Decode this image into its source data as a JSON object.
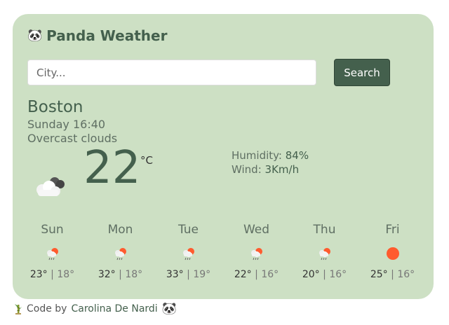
{
  "app": {
    "title": "Panda Weather",
    "brand_color": "#44604d",
    "card_color": "#cde0c4"
  },
  "search": {
    "placeholder": "City...",
    "value": "",
    "button_label": "Search"
  },
  "current": {
    "city": "Boston",
    "datetime": "Sunday 16:40",
    "description": "Overcast clouds",
    "icon": "overcast-clouds-icon",
    "temperature": "22",
    "unit": "°C",
    "humidity_label": "Humidity:",
    "humidity_value": "84%",
    "wind_label": "Wind:",
    "wind_value": "3Km/h"
  },
  "forecast": [
    {
      "day": "Sun",
      "max": "23°",
      "min": "18°",
      "icon": "rain-sun-icon"
    },
    {
      "day": "Mon",
      "max": "32°",
      "min": "18°",
      "icon": "rain-sun-icon"
    },
    {
      "day": "Tue",
      "max": "33°",
      "min": "19°",
      "icon": "rain-sun-icon"
    },
    {
      "day": "Wed",
      "max": "22°",
      "min": "16°",
      "icon": "rain-sun-icon"
    },
    {
      "day": "Thu",
      "max": "20°",
      "min": "16°",
      "icon": "rain-sun-icon"
    },
    {
      "day": "Fri",
      "max": "25°",
      "min": "16°",
      "icon": "sun-icon"
    }
  ],
  "separator": "|",
  "footer": {
    "prefix": "Code by",
    "author": "Carolina De Nardi"
  }
}
